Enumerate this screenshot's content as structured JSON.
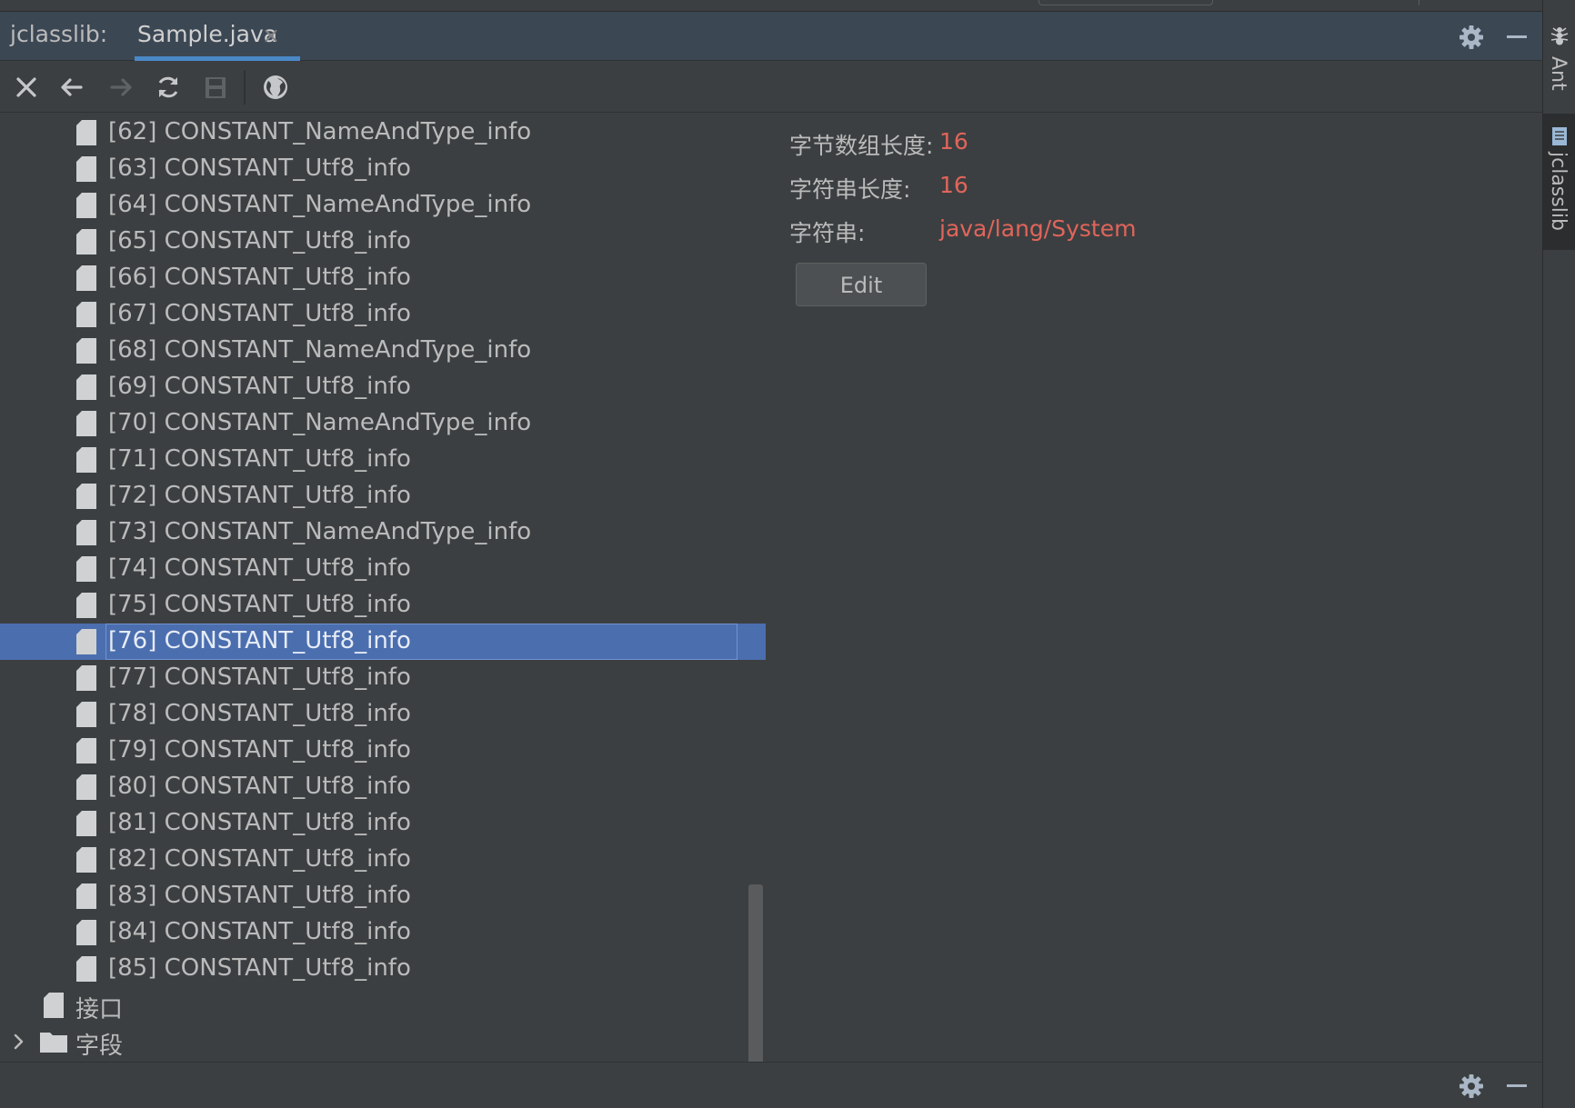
{
  "tool_window": {
    "title": "jclasslib:",
    "tab_label": "Sample.java",
    "tab_close": "×"
  },
  "toolbar": {
    "buttons": [
      "close-icon",
      "back-arrow-icon",
      "forward-arrow-icon",
      "refresh-icon",
      "save-icon",
      "globe-icon"
    ]
  },
  "tree": {
    "items": [
      {
        "label": "[62] CONSTANT_NameAndType_info"
      },
      {
        "label": "[63] CONSTANT_Utf8_info"
      },
      {
        "label": "[64] CONSTANT_NameAndType_info"
      },
      {
        "label": "[65] CONSTANT_Utf8_info"
      },
      {
        "label": "[66] CONSTANT_Utf8_info"
      },
      {
        "label": "[67] CONSTANT_Utf8_info"
      },
      {
        "label": "[68] CONSTANT_NameAndType_info"
      },
      {
        "label": "[69] CONSTANT_Utf8_info"
      },
      {
        "label": "[70] CONSTANT_NameAndType_info"
      },
      {
        "label": "[71] CONSTANT_Utf8_info"
      },
      {
        "label": "[72] CONSTANT_Utf8_info"
      },
      {
        "label": "[73] CONSTANT_NameAndType_info"
      },
      {
        "label": "[74] CONSTANT_Utf8_info"
      },
      {
        "label": "[75] CONSTANT_Utf8_info"
      },
      {
        "label": "[76] CONSTANT_Utf8_info"
      },
      {
        "label": "[77] CONSTANT_Utf8_info"
      },
      {
        "label": "[78] CONSTANT_Utf8_info"
      },
      {
        "label": "[79] CONSTANT_Utf8_info"
      },
      {
        "label": "[80] CONSTANT_Utf8_info"
      },
      {
        "label": "[81] CONSTANT_Utf8_info"
      },
      {
        "label": "[82] CONSTANT_Utf8_info"
      },
      {
        "label": "[83] CONSTANT_Utf8_info"
      },
      {
        "label": "[84] CONSTANT_Utf8_info"
      },
      {
        "label": "[85] CONSTANT_Utf8_info"
      }
    ],
    "selected_label": "[76] CONSTANT_Utf8_info",
    "interfaces_label": "接口",
    "fields_label": "字段"
  },
  "detail": {
    "byte_length_label": "字节数组长度:",
    "byte_length_value": "16",
    "string_length_label": "字符串长度:",
    "string_length_value": "16",
    "string_label": "字符串:",
    "string_value": "java/lang/System",
    "edit_button": "Edit"
  },
  "side_bar": {
    "ant_label": "Ant",
    "jclasslib_label": "jclasslib"
  },
  "colors": {
    "accent": "#4a88c7",
    "selection": "#4b6eaf",
    "value_red": "#e0655b",
    "background": "#3c3f41"
  }
}
